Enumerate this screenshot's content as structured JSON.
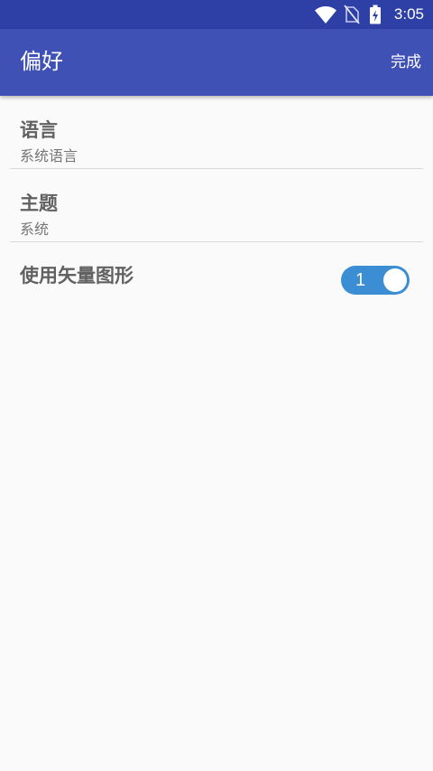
{
  "status_bar": {
    "time": "3:05",
    "icons": [
      "wifi-icon",
      "no-sim-icon",
      "battery-charging-icon"
    ]
  },
  "app_bar": {
    "title": "偏好",
    "done_label": "完成",
    "background_color": "#3f51b5",
    "status_bar_color": "#2e3fa6"
  },
  "settings": {
    "language": {
      "title": "语言",
      "value": "系统语言"
    },
    "theme": {
      "title": "主题",
      "value": "系统"
    },
    "vector_graphics": {
      "title": "使用矢量图形",
      "toggle_text": "1",
      "toggle_on": true,
      "toggle_color": "#3b8ed3"
    }
  }
}
